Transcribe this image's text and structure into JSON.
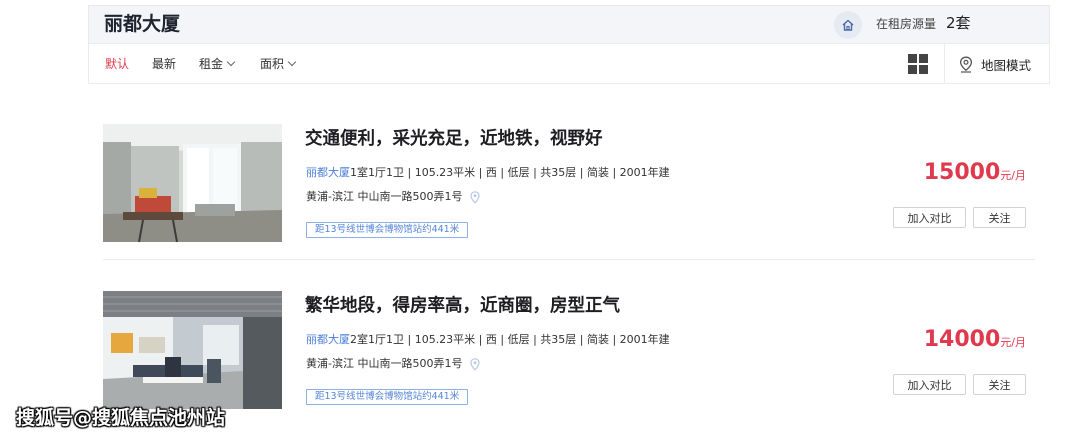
{
  "header": {
    "title": "丽都大厦",
    "home_icon": "home-icon",
    "rent_count_label": "在租房源量",
    "rent_count_value": "2套"
  },
  "toolbar": {
    "sort_options": [
      {
        "label": "默认",
        "active": true
      },
      {
        "label": "最新",
        "active": false
      },
      {
        "label": "租金",
        "active": false,
        "dropdown": true
      },
      {
        "label": "面积",
        "active": false,
        "dropdown": true
      }
    ],
    "grid_icon": "grid-view-icon",
    "map_mode_label": "地图模式",
    "map_icon": "map-pin-icon"
  },
  "colors": {
    "accent_red": "#e03a4a",
    "link_blue": "#4c7fd9"
  },
  "listings": [
    {
      "title": "交通便利，采光充足，近地铁，视野好",
      "community": "丽都大厦",
      "details": "1室1厅1卫 | 105.23平米 | 西 | 低层 | 共35层 | 简装 | 2001年建",
      "address": "黄浦-滨江 中山南一路500弄1号",
      "tag": "距13号线世博会博物馆站约441米",
      "price": "15000",
      "price_unit": "元/月",
      "compare_label": "加入对比",
      "follow_label": "关注"
    },
    {
      "title": "繁华地段，得房率高，近商圈，房型正气",
      "community": "丽都大厦",
      "details": "2室1厅1卫 | 105.23平米 | 西 | 低层 | 共35层 | 简装 | 2001年建",
      "address": "黄浦-滨江 中山南一路500弄1号",
      "tag": "距13号线世博会博物馆站约441米",
      "price": "14000",
      "price_unit": "元/月",
      "compare_label": "加入对比",
      "follow_label": "关注"
    }
  ],
  "watermark": "搜狐号@搜狐焦点池州站"
}
